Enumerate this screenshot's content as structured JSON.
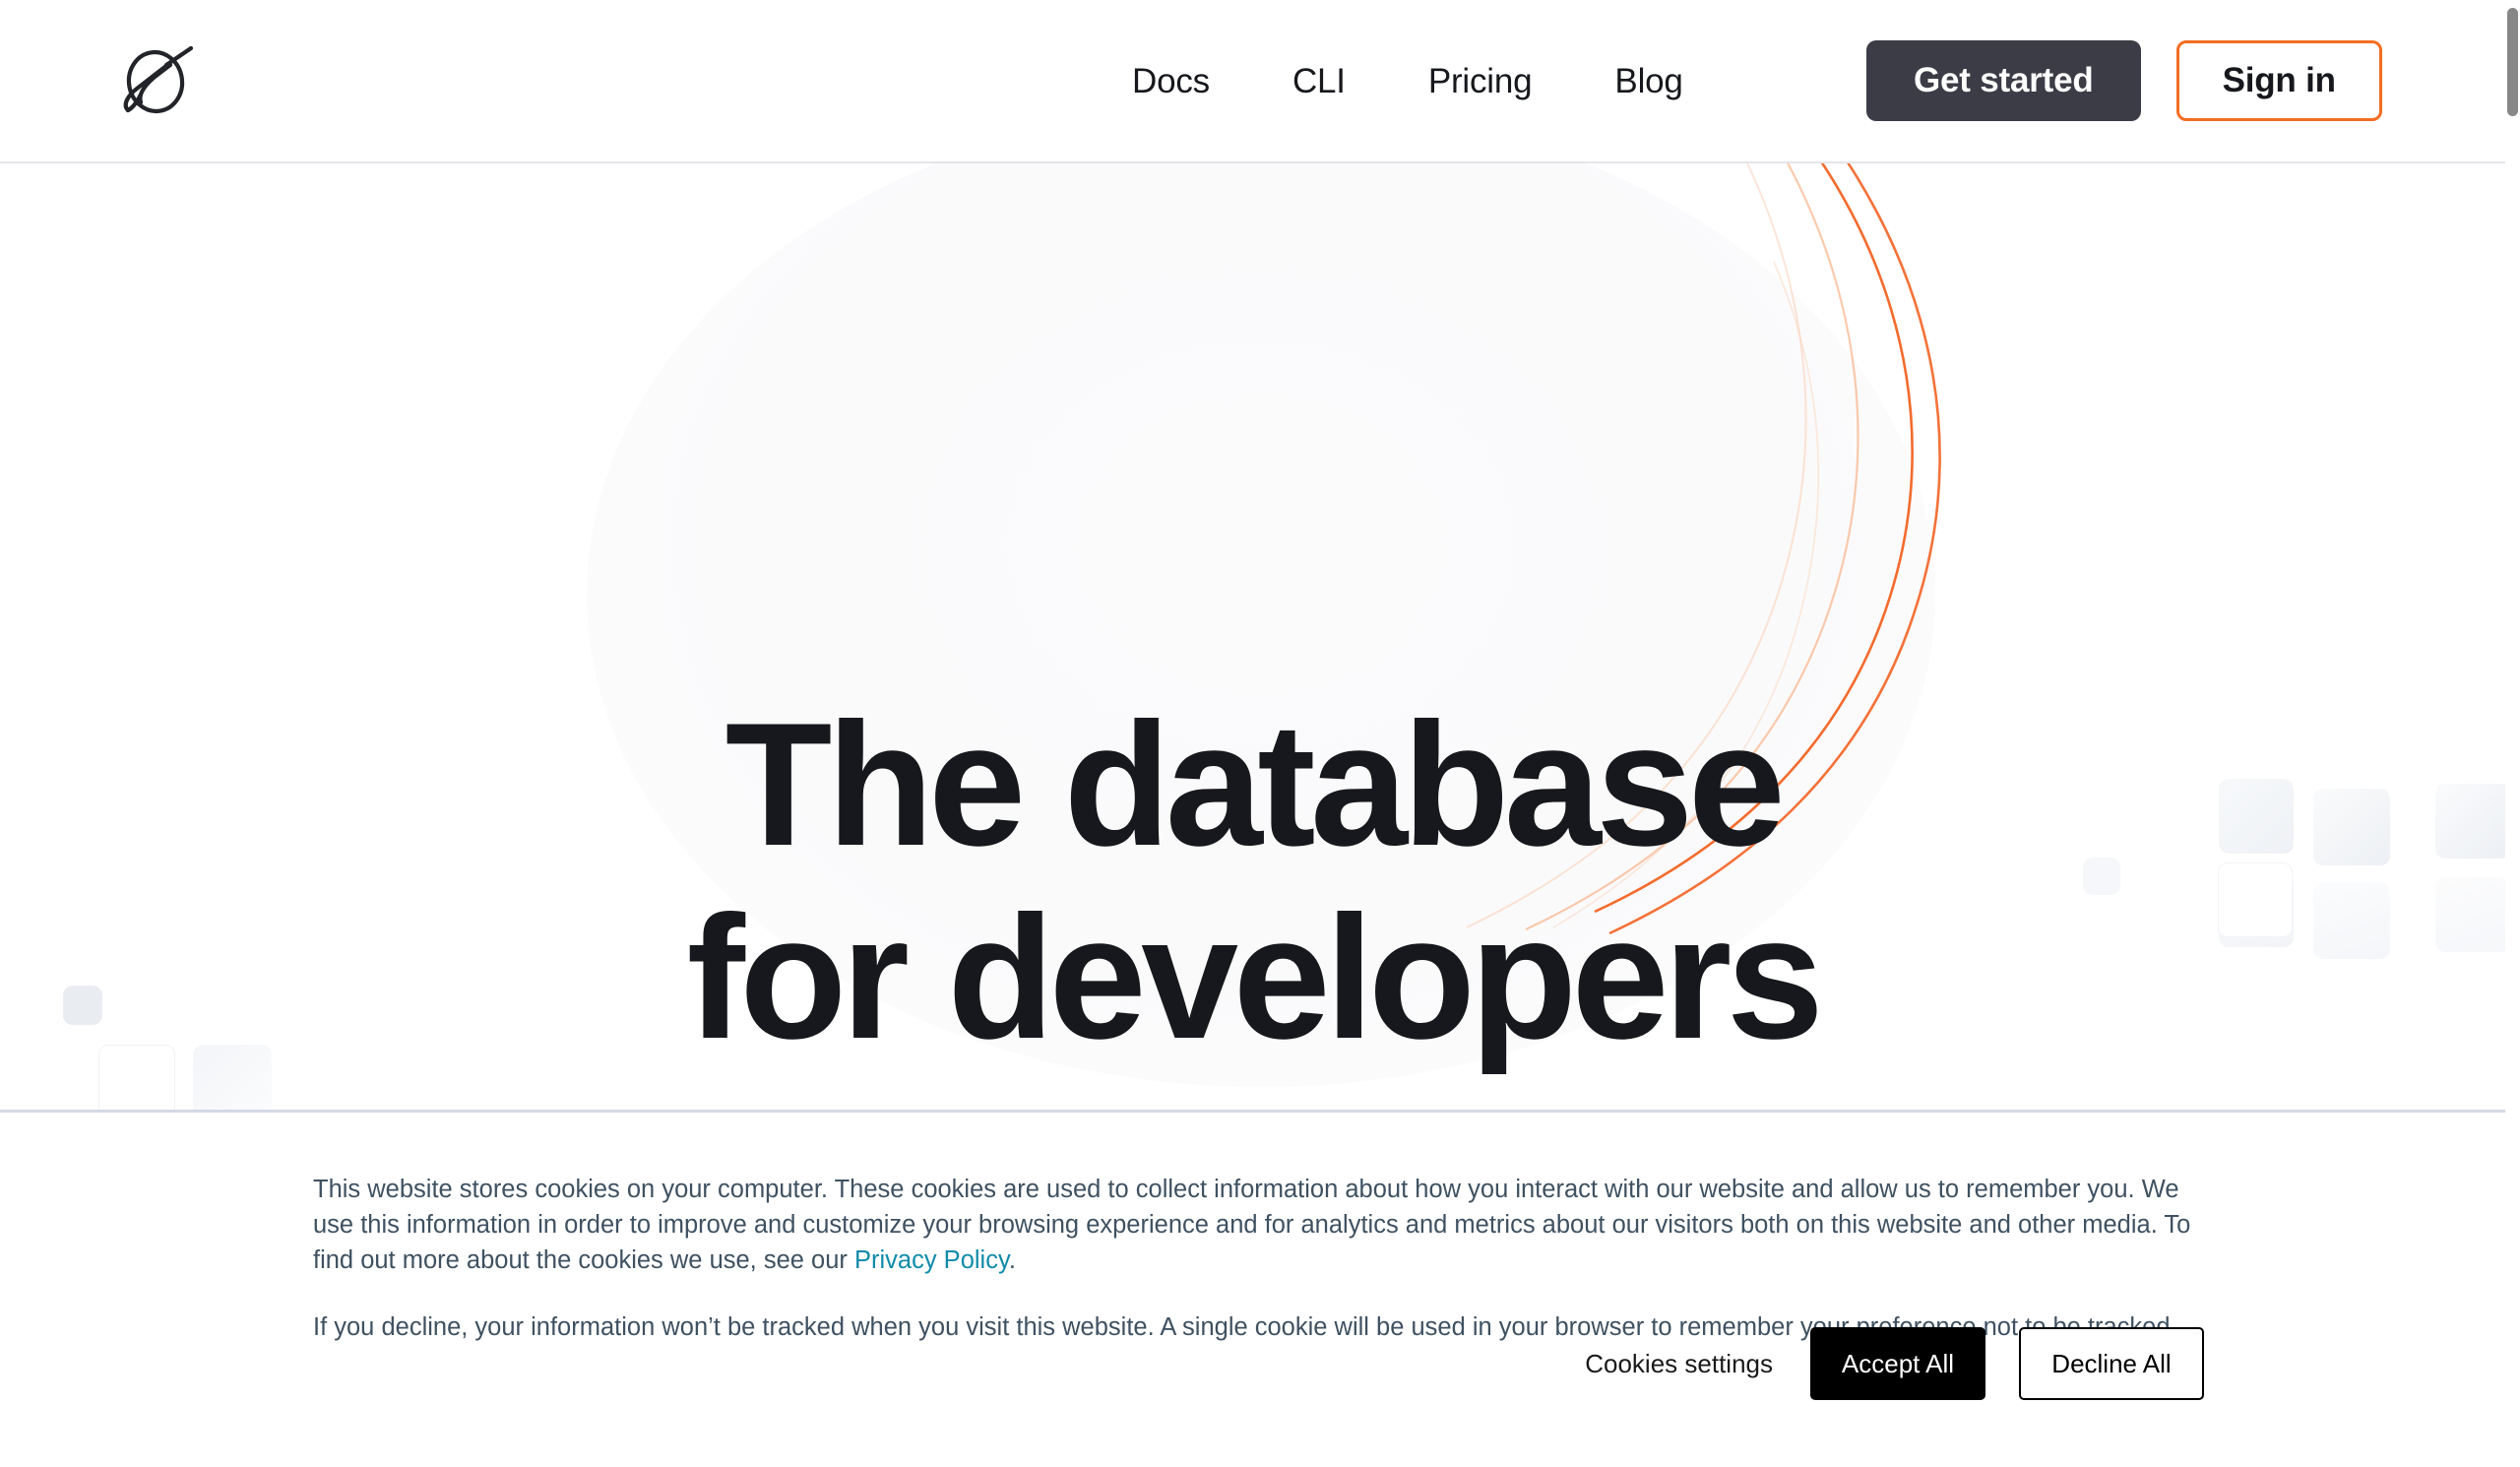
{
  "header": {
    "logo_name": "neon-logo",
    "nav": [
      {
        "label": "Docs"
      },
      {
        "label": "CLI"
      },
      {
        "label": "Pricing"
      },
      {
        "label": "Blog"
      }
    ],
    "get_started_label": "Get started",
    "sign_in_label": "Sign in"
  },
  "hero": {
    "title_line1": "The database",
    "title_line2": "for developers"
  },
  "cookie_banner": {
    "paragraph1_before_link": "This website stores cookies on your computer. These cookies are used to collect information about how you interact with our website and allow us to remember you. We use this information in order to improve and customize your browsing experience and for analytics and metrics about our visitors both on this website and other media. To find out more about the cookies we use, see our ",
    "privacy_link_label": "Privacy Policy",
    "paragraph1_after_link": ".",
    "paragraph2": "If you decline, your information won’t be tracked when you visit this website. A single cookie will be used in your browser to remember your preference not to be tracked.",
    "settings_label": "Cookies settings",
    "accept_label": "Accept All",
    "decline_label": "Decline All"
  },
  "colors": {
    "brand_orange": "#f36d22",
    "text_dark": "#16181d",
    "button_dark": "#3c3c47",
    "link_teal": "#118baa",
    "cookie_text": "#3f5161",
    "banner_border": "#d3d9e4",
    "header_border": "#e4e5e9",
    "scrollbar_thumb": "#878787"
  }
}
